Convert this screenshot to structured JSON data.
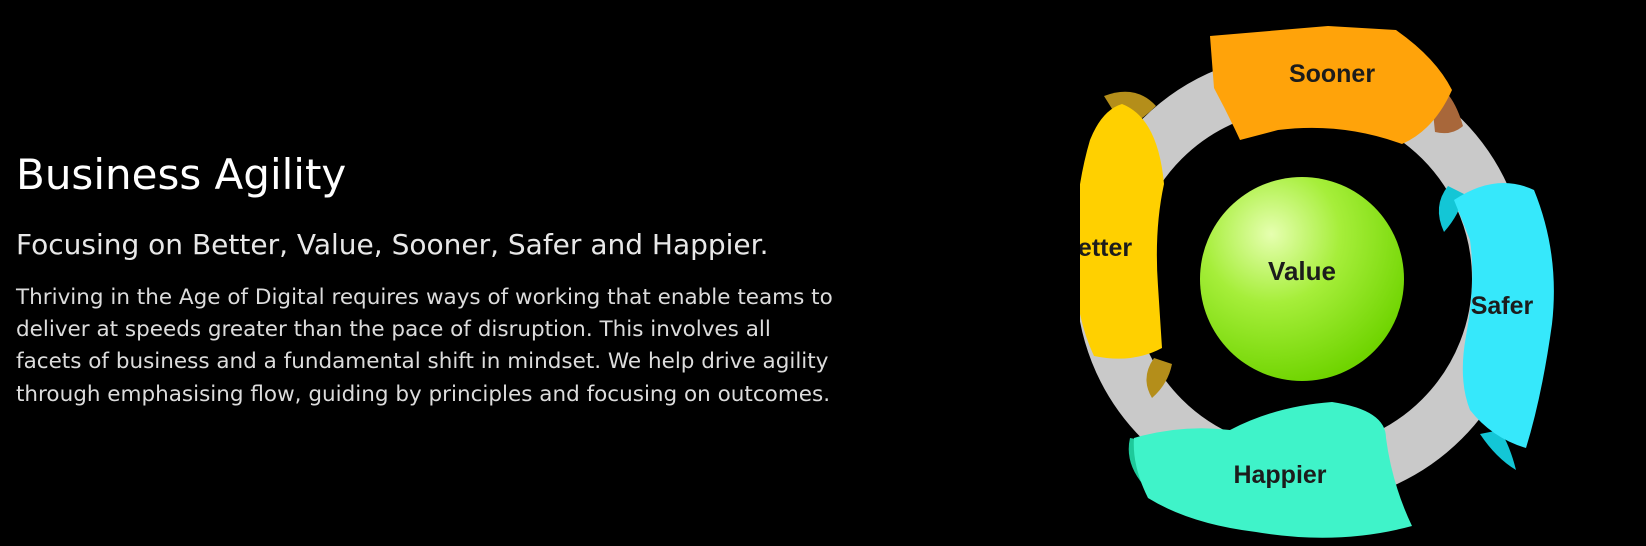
{
  "content": {
    "title": "Business Agility",
    "subtitle": "Focusing on Better, Value, Sooner, Safer and Happier.",
    "body": "Thriving in the Age of Digital requires ways of working that enable teams to deliver at speeds greater than the pace of disruption. This involves all facets of business and a fundamental shift in mindset. We help drive agility through emphasising flow, guiding by principles and focusing on outcomes."
  },
  "diagram": {
    "center": "Value",
    "segments": {
      "sooner": "Sooner",
      "safer": "Safer",
      "happier": "Happier",
      "better": "Better"
    },
    "colors": {
      "ring": "#c9c9c9",
      "sooner": "#ffa30a",
      "safer": "#36e8fb",
      "happier": "#3ff3c9",
      "better": "#ffd000",
      "value": "#8ee51c"
    }
  }
}
